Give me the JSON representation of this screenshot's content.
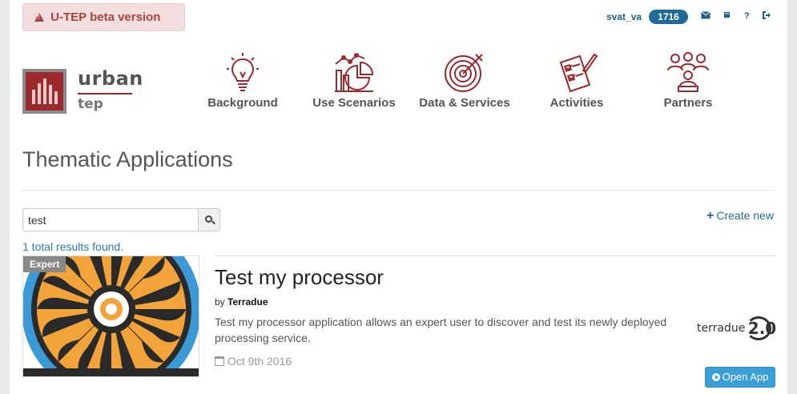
{
  "banner": {
    "icon": "warning-icon",
    "text": "U-TEP beta version"
  },
  "user": {
    "name": "svat_va",
    "count": "1716",
    "icons": [
      "envelope-icon",
      "book-icon",
      "question-icon",
      "sign-out-icon"
    ],
    "question_glyph": "?"
  },
  "logo": {
    "word1": "urban",
    "word2": "tep",
    "color": "#9a2a2e"
  },
  "nav": [
    {
      "label": "Background",
      "icon": "lightbulb-icon"
    },
    {
      "label": "Use Scenarios",
      "icon": "chart-icon"
    },
    {
      "label": "Data & Services",
      "icon": "target-icon"
    },
    {
      "label": "Activities",
      "icon": "checklist-icon"
    },
    {
      "label": "Partners",
      "icon": "people-icon"
    }
  ],
  "page": {
    "title": "Thematic Applications"
  },
  "search": {
    "value": "test",
    "icon": "search-icon"
  },
  "create": {
    "label": "Create new",
    "plus": "+"
  },
  "results": {
    "text": "1 total results found."
  },
  "app": {
    "badge": "Expert",
    "title": "Test my processor",
    "by_prefix": "by",
    "by_author": "Terradue",
    "description": "Test my processor application allows an expert user to discover and test its newly deployed processing service.",
    "date": "Oct 9th 2016",
    "open_label": "Open App",
    "vendor_logo_text": "terradue",
    "vendor_logo_num": "2.0"
  },
  "colors": {
    "accent": "#1f6a96",
    "brand": "#9a2a2e",
    "button": "#3a9fd4",
    "beta_bg": "#f2dede",
    "beta_text": "#a94442"
  }
}
